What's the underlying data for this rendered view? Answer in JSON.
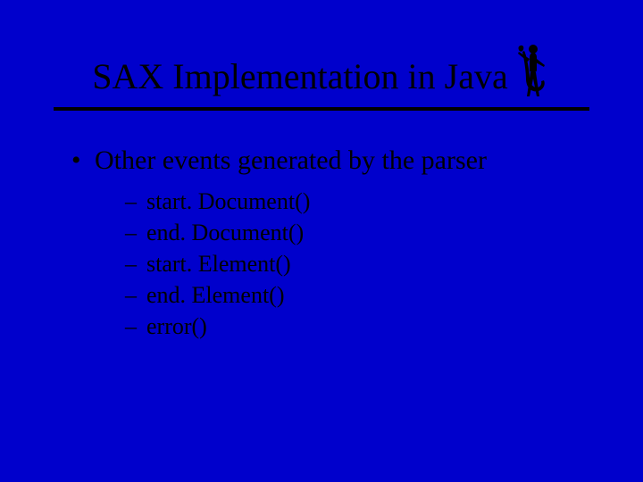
{
  "slide": {
    "title": "SAX Implementation in Java",
    "icon": "saxophonist-icon",
    "bullets": [
      {
        "text": "Other events generated by the parser",
        "children": [
          {
            "text": "start. Document()"
          },
          {
            "text": "end. Document()"
          },
          {
            "text": "start. Element()"
          },
          {
            "text": "end. Element()"
          },
          {
            "text": "error()"
          }
        ]
      }
    ]
  },
  "colors": {
    "background": "#0000cc",
    "text": "#000000",
    "rule": "#000000"
  }
}
